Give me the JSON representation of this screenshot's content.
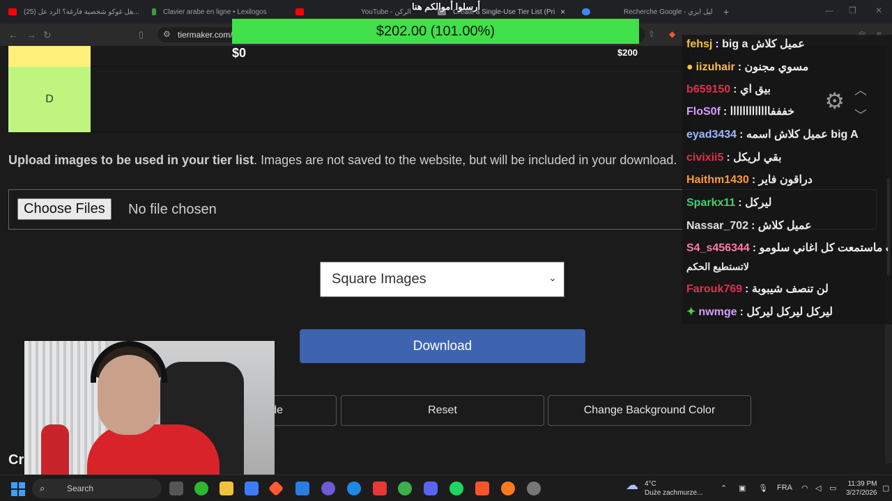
{
  "browser": {
    "tabs": [
      {
        "label": "(25) هل غوكو شخصية فارغة؟ الرد عل...",
        "favicon_color": "#ff0000",
        "icon": "youtube-icon"
      },
      {
        "label": "Clavier arabe en ligne • Lexilogos",
        "favicon_color": "#3c9a3c",
        "icon": "lexilogos-icon"
      },
      {
        "label": "",
        "favicon_color": "#ff0000",
        "icon": "youtube-icon"
      },
      {
        "label": "YouTube - الركن",
        "favicon_color": "#ff0000",
        "icon": "youtube-icon"
      },
      {
        "label": "Create a Single-Use Tier List (Pri",
        "favicon_color": "#888888",
        "icon": "tiermaker-icon"
      },
      {
        "label": "",
        "favicon_color": "#4285f4",
        "icon": "google-icon"
      },
      {
        "label": "Recherche Google - ليل ايزي",
        "favicon_color": "#4285f4",
        "icon": "google-icon"
      }
    ],
    "tab_close": "×",
    "new_tab": "+",
    "url": "tiermaker.com/"
  },
  "overlay": {
    "goal_header": "أرسلوا أموالكم هنا",
    "goal_amount": "$202.00 (101.00%)",
    "goal_start": "$0",
    "goal_end": "$200",
    "accent": "#3fe04a"
  },
  "tiers": [
    {
      "label": "",
      "color": "#fff07a"
    },
    {
      "label": "D",
      "color": "#bff57e"
    }
  ],
  "upload": {
    "bold": "Upload images to be used in your tier list",
    "rest": ". Images are not saved to the website, but will be included in your download.",
    "choose_label": "Choose Files",
    "no_file": "No file chosen"
  },
  "image_shape_select": {
    "value": "Square Images"
  },
  "download_label": "Download",
  "buttons": {
    "hide_partial": "de",
    "reset": "Reset",
    "change_bg": "Change Background Color"
  },
  "cr_text": "Cr",
  "chat": [
    {
      "user": "fehsj",
      "color": "#f3c13a",
      "msg": ": big a عميل كلاش"
    },
    {
      "user": "iizuhair",
      "color": "#f3c13a",
      "msg": ": مسوي مجنون",
      "badge": true
    },
    {
      "user": "b659150",
      "color": "#e03050",
      "msg": ": بيق اي"
    },
    {
      "user": "FloS0f",
      "color": "#d59cff",
      "msg": ": خفففااااااااااااا"
    },
    {
      "user": "eyad3434",
      "color": "#9fb8ff",
      "msg": ": عميل كلاش اسمه big A"
    },
    {
      "user": "civixii5",
      "color": "#e03050",
      "msg": ": بقي لريكل"
    },
    {
      "user": "Haithm1430",
      "color": "#ff9a3c",
      "msg": ": دراقون فاير"
    },
    {
      "user": "Sparkx11",
      "color": "#3ed070",
      "msg": ": ليركل"
    },
    {
      "user": "Nassar_702",
      "color": "#e0e0e0",
      "msg": ": عميل كلاش"
    },
    {
      "user": "S4_s456344",
      "color": "#ff7aa8",
      "msg": ": انت ماستمعت كل اغاني سلومو"
    },
    {
      "user": "",
      "color": "#e0e0e0",
      "msg": "لاتستطيع الحكم"
    },
    {
      "user": "Farouk769",
      "color": "#e03050",
      "msg": ": لن تنصف شيبوبة"
    },
    {
      "user": "nwmge",
      "color": "#d59cff",
      "msg": ": ليركل ليركل ليركل",
      "badge": true
    }
  ],
  "taskbar": {
    "search_label": "Search",
    "weather_temp": "4°C",
    "weather_desc": "Duże zachmurze...",
    "lang": "FRA",
    "time": "11:39 PM",
    "date": "3/27/2026"
  }
}
